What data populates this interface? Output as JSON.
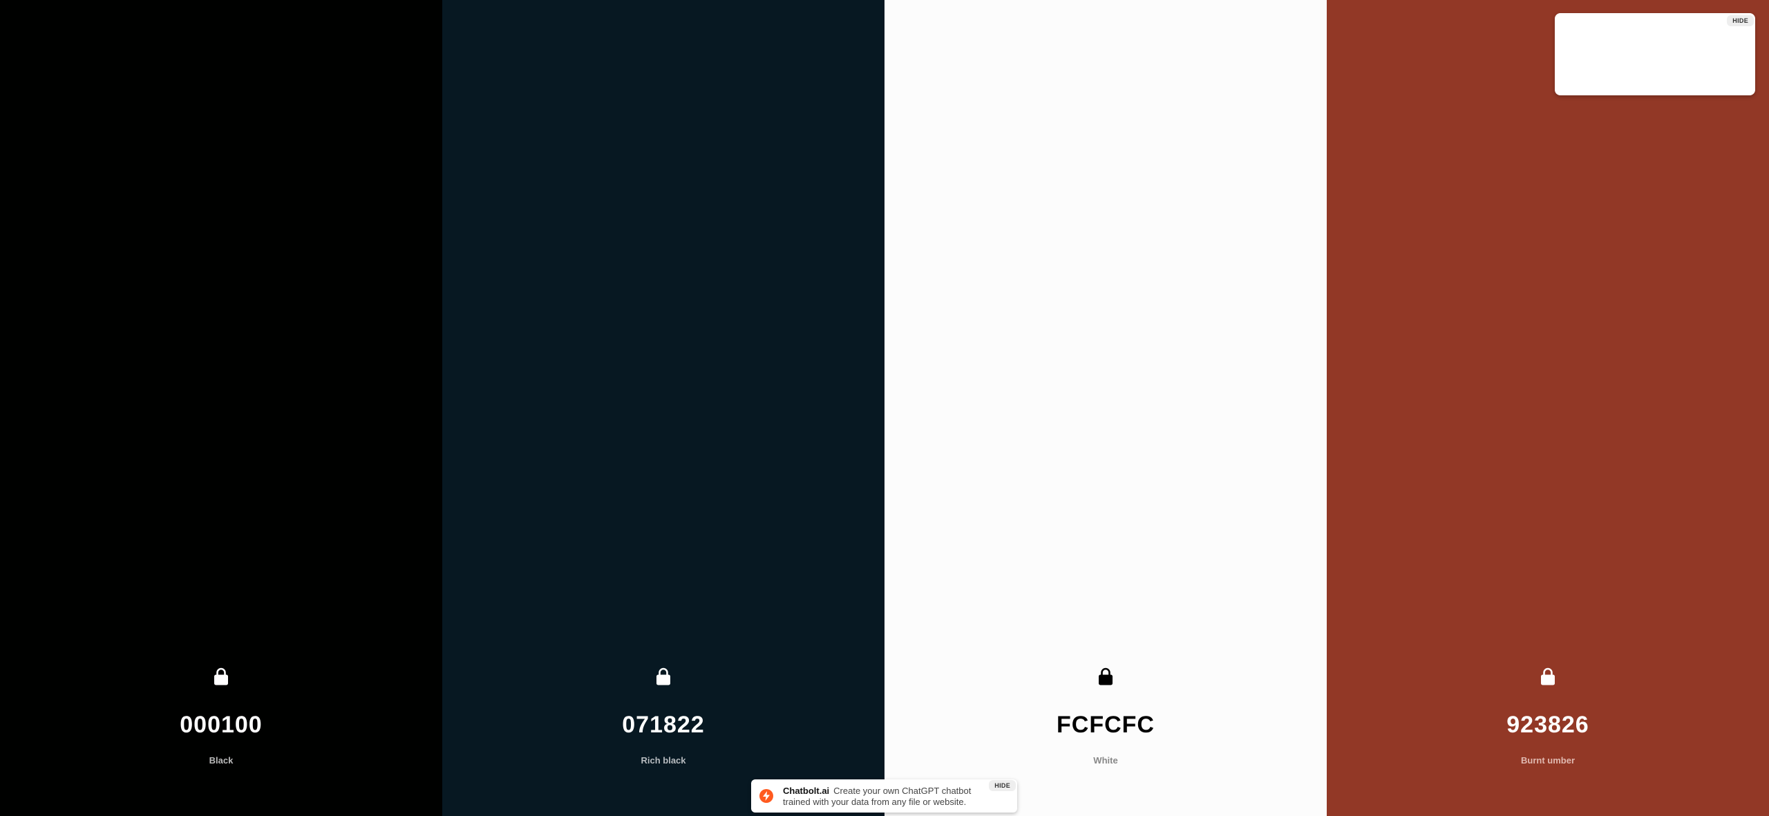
{
  "swatches": [
    {
      "hex": "000100",
      "name": "Black",
      "color": "#000100",
      "text_color": "#ffffff",
      "name_color": "#bbbbbb",
      "lock_color": "#ffffff"
    },
    {
      "hex": "071822",
      "name": "Rich black",
      "color": "#071822",
      "text_color": "#ffffff",
      "name_color": "#b8bcc0",
      "lock_color": "#ffffff"
    },
    {
      "hex": "FCFCFC",
      "name": "White",
      "color": "#fcfcfc",
      "text_color": "#000000",
      "name_color": "#888888",
      "lock_color": "#000000"
    },
    {
      "hex": "923826",
      "name": "Burnt umber",
      "color": "#923826",
      "text_color": "#ffffff",
      "name_color": "#e0b9b0",
      "lock_color": "#ffffff"
    }
  ],
  "icons": {
    "lock": "lock-icon",
    "logo": "chatbolt-logo-icon"
  },
  "ad": {
    "hide_label": "HIDE"
  },
  "banner": {
    "brand": "Chatbolt.ai",
    "message": "Create your own ChatGPT chatbot trained with your data from any file or website.",
    "hide_label": "HIDE",
    "brand_color": "#ff5a1f"
  }
}
